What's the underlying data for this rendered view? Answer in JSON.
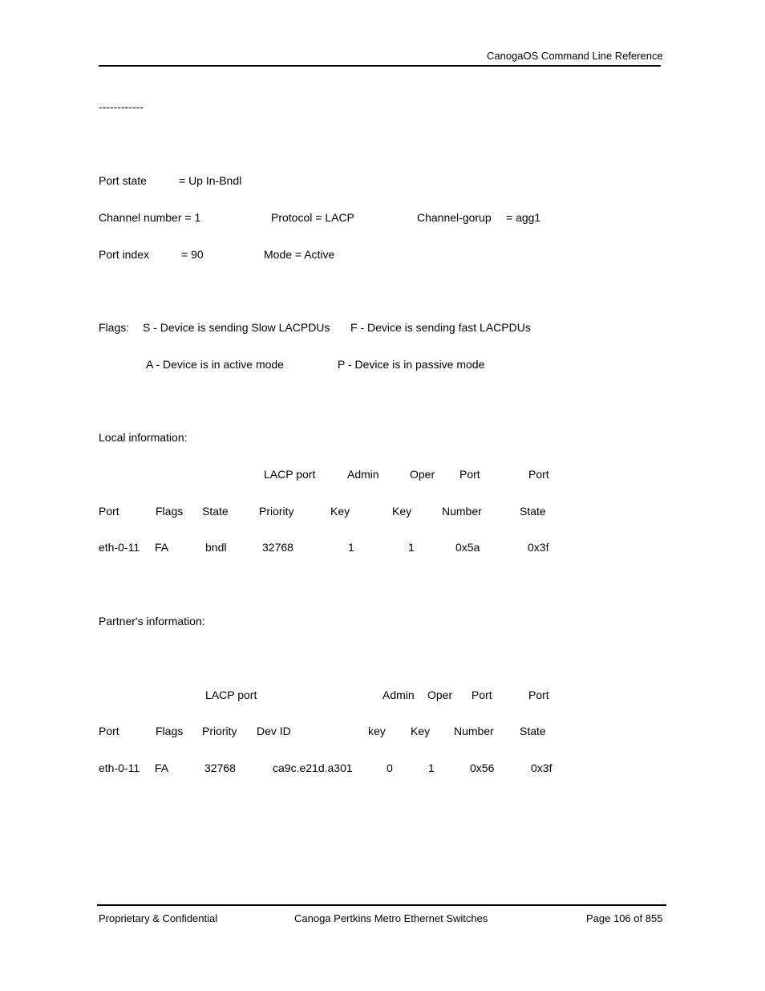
{
  "header": {
    "title": "CanogaOS Command Line Reference"
  },
  "separator_text": "------------",
  "status": {
    "port_state_label": "Port state",
    "port_state_value": "= Up In-Bndl",
    "channel_number": "Channel number = 1",
    "protocol": "Protocol = LACP",
    "channel_group_label": "Channel-gorup",
    "channel_group_value": "= agg1",
    "port_index_label": "Port index",
    "port_index_value": "= 90",
    "mode": "Mode = Active"
  },
  "flags": {
    "label": "Flags:",
    "s": "S - Device is sending Slow LACPDUs",
    "f": "F - Device is sending fast LACPDUs",
    "a": "A - Device is in active mode",
    "p": "P - Device is in passive mode"
  },
  "local": {
    "title": "Local information:",
    "header_row1": [
      "LACP port",
      "Admin",
      "Oper",
      "Port",
      "Port"
    ],
    "header_row2": [
      "Port",
      "Flags",
      "State",
      "Priority",
      "Key",
      "Key",
      "Number",
      "State"
    ],
    "rows": [
      [
        "eth-0-11",
        "FA",
        "bndl",
        "32768",
        "1",
        "1",
        "0x5a",
        "0x3f"
      ]
    ]
  },
  "partner": {
    "title": "Partner's information:",
    "header_row1": [
      "LACP port",
      "Admin",
      "Oper",
      "Port",
      "Port"
    ],
    "header_row2": [
      "Port",
      "Flags",
      "Priority",
      "Dev ID",
      "key",
      "Key",
      "Number",
      "State"
    ],
    "rows": [
      [
        "eth-0-11",
        "FA",
        "32768",
        "ca9c.e21d.a301",
        "0",
        "1",
        "0x56",
        "0x3f"
      ]
    ]
  },
  "footer": {
    "left": "Proprietary & Confidential",
    "center": "Canoga Pertkins Metro Ethernet Switches",
    "right": "Page 106 of 855"
  }
}
